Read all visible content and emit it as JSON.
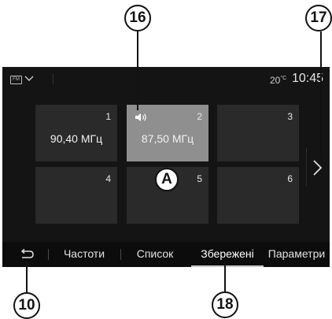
{
  "status_bar": {
    "source_label": "FM",
    "temperature": "20",
    "temperature_unit": "°C",
    "time": "10:45"
  },
  "presets": [
    {
      "number": "1",
      "frequency": "90,40 МГц",
      "active": false
    },
    {
      "number": "2",
      "frequency": "87,50 МГц",
      "active": true
    },
    {
      "number": "3",
      "frequency": "",
      "active": false
    },
    {
      "number": "4",
      "frequency": "",
      "active": false
    },
    {
      "number": "5",
      "frequency": "",
      "active": false
    },
    {
      "number": "6",
      "frequency": "",
      "active": false
    }
  ],
  "tabs": [
    {
      "label": "Частоти",
      "active": false
    },
    {
      "label": "Список",
      "active": false
    },
    {
      "label": "Збережені",
      "active": true
    },
    {
      "label": "Параметри",
      "active": false
    }
  ],
  "icons": {
    "source": "fm-icon",
    "source_menu": "chevron-down-icon",
    "volume": "speaker-icon",
    "next": "chevron-right-icon",
    "back": "back-arrow-icon"
  },
  "callouts": {
    "c16": "16",
    "c17": "17",
    "c10": "10",
    "c18": "18",
    "cA": "A"
  }
}
